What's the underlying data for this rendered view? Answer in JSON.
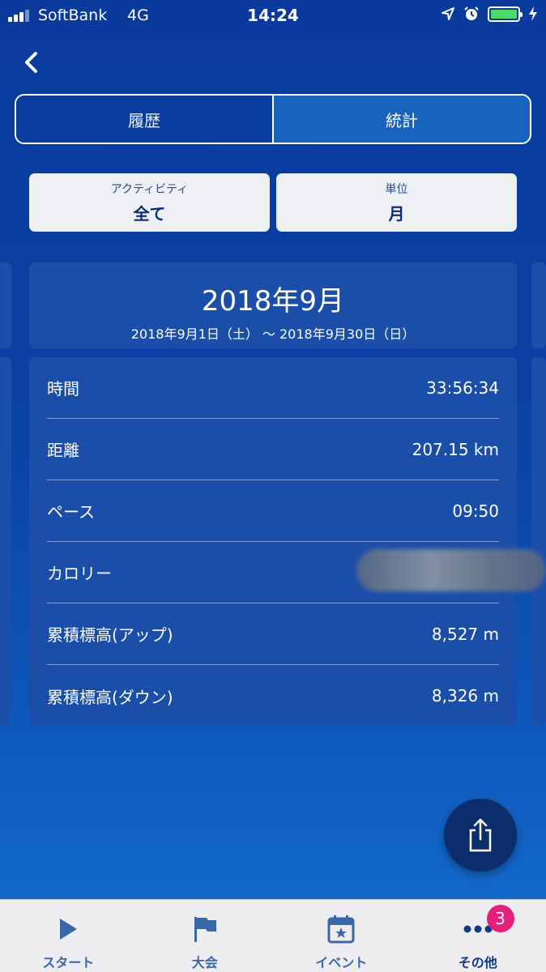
{
  "status_bar": {
    "carrier": "SoftBank",
    "network": "4G",
    "time": "14:24"
  },
  "segments": {
    "history_label": "履歴",
    "stats_label": "統計",
    "active": "stats"
  },
  "filters": {
    "activity_caption": "アクティビティ",
    "activity_value": "全て",
    "unit_caption": "単位",
    "unit_value": "月"
  },
  "period": {
    "title": "2018年9月",
    "range": "2018年9月1日（土） 〜 2018年9月30日（日）"
  },
  "stats": [
    {
      "label": "時間",
      "value": "33:56:34"
    },
    {
      "label": "距離",
      "value": "207.15 km"
    },
    {
      "label": "ペース",
      "value": "09:50"
    },
    {
      "label": "カロリー",
      "value": ""
    },
    {
      "label": "累積標高(アップ)",
      "value": "8,527 m"
    },
    {
      "label": "累積標高(ダウン)",
      "value": "8,326 m"
    }
  ],
  "tabs": [
    {
      "label": "スタート",
      "icon": "play-icon"
    },
    {
      "label": "大会",
      "icon": "flag-icon"
    },
    {
      "label": "イベント",
      "icon": "calendar-star-icon"
    },
    {
      "label": "その他",
      "icon": "more-dots-icon",
      "badge": "3"
    }
  ],
  "colors": {
    "background": "#0b42a6",
    "card": "#1b4ea8",
    "badge": "#e5207c",
    "battery": "#4cd964"
  }
}
